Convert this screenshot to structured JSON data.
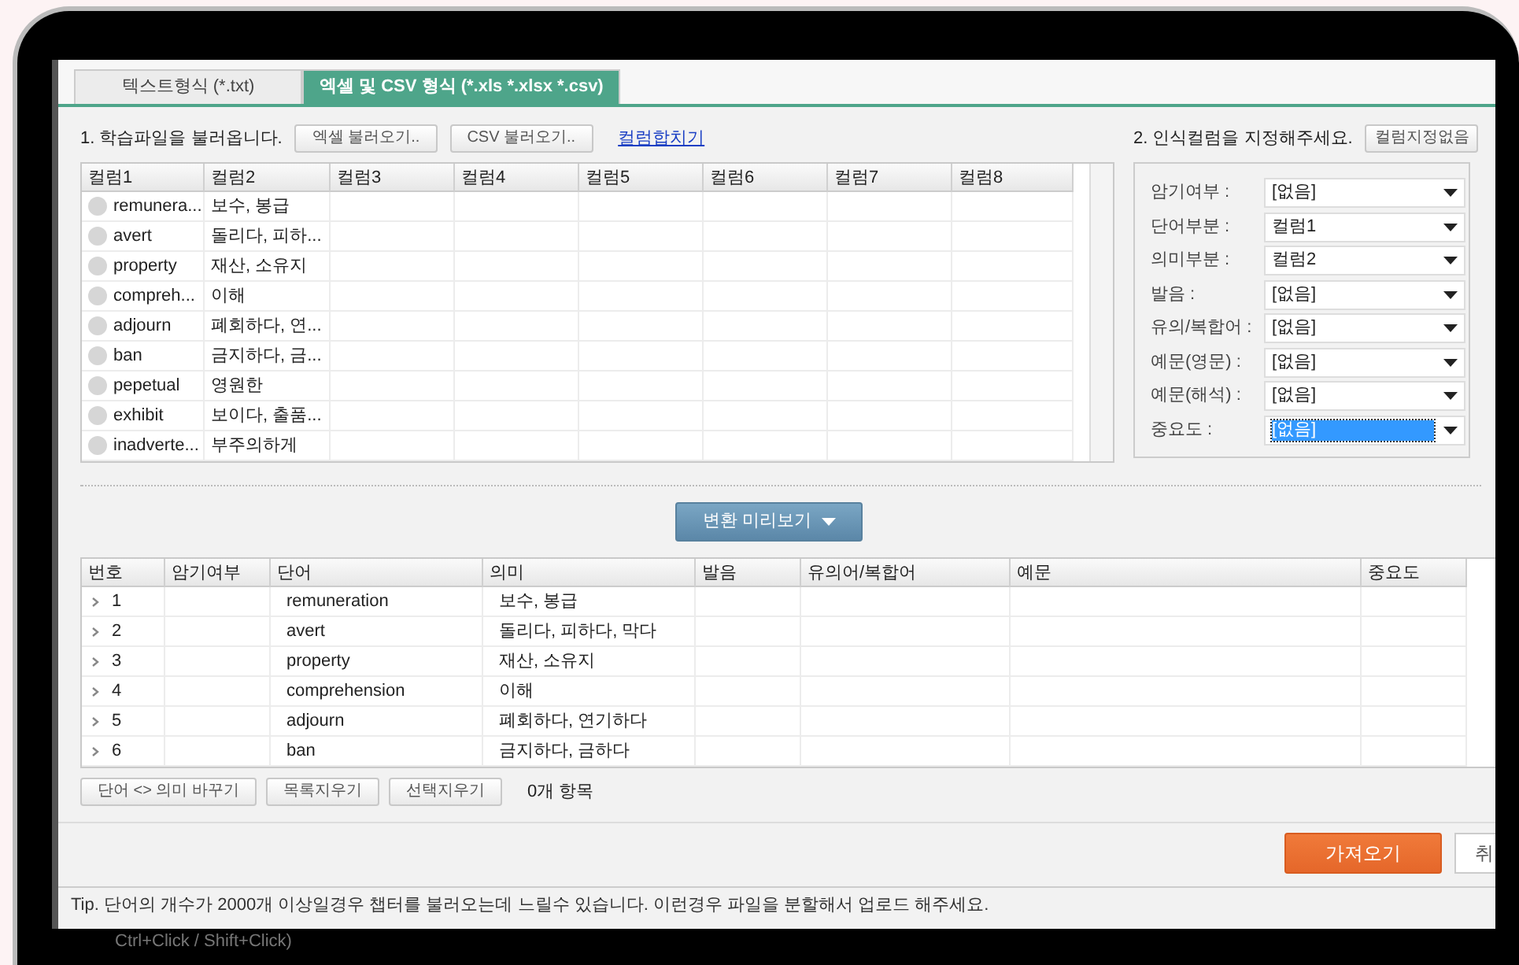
{
  "tabs": [
    {
      "label": "텍스트형식 (*.txt)",
      "selected": false
    },
    {
      "label": "엑셀 및 CSV 형식 (*.xls *.xlsx *.csv)",
      "selected": true
    }
  ],
  "load_section": {
    "label": "1. 학습파일을 불러옵니다.",
    "buttons": [
      "엑셀 불러오기..",
      "CSV 불러오기.."
    ],
    "link": "컬럼합치기"
  },
  "source_table": {
    "columns": [
      "컬럼1",
      "컬럼2",
      "컬럼3",
      "컬럼4",
      "컬럼5",
      "컬럼6",
      "컬럼7",
      "컬럼8"
    ],
    "rows": [
      {
        "checked": false,
        "cells": [
          "remunera...",
          "보수, 봉급"
        ]
      },
      {
        "checked": false,
        "cells": [
          "avert",
          "돌리다, 피하..."
        ]
      },
      {
        "checked": false,
        "cells": [
          "property",
          "재산, 소유지"
        ]
      },
      {
        "checked": false,
        "cells": [
          "compreh...",
          "이해"
        ]
      },
      {
        "checked": false,
        "cells": [
          "adjourn",
          "폐회하다, 연..."
        ]
      },
      {
        "checked": false,
        "cells": [
          "ban",
          "금지하다, 금..."
        ]
      },
      {
        "checked": false,
        "cells": [
          "pepetual",
          "영원한"
        ]
      },
      {
        "checked": false,
        "cells": [
          "exhibit",
          "보이다, 출품..."
        ]
      },
      {
        "checked": false,
        "cells": [
          "inadverte...",
          "부주의하게"
        ]
      }
    ]
  },
  "mapping_section": {
    "label": "2. 인식컬럼을 지정해주세요.",
    "button": "컬럼지정없음",
    "fields": [
      {
        "label": "암기여부 :",
        "value": "[없음]",
        "selected": false
      },
      {
        "label": "단어부분 :",
        "value": "컬럼1",
        "selected": false
      },
      {
        "label": "의미부분 :",
        "value": "컬럼2",
        "selected": false
      },
      {
        "label": "발음 :",
        "value": "[없음]",
        "selected": false
      },
      {
        "label": "유의/복합어 :",
        "value": "[없음]",
        "selected": false
      },
      {
        "label": "예문(영문) :",
        "value": "[없음]",
        "selected": false
      },
      {
        "label": "예문(해석) :",
        "value": "[없음]",
        "selected": false
      },
      {
        "label": "중요도 :",
        "value": "[없음]",
        "selected": true
      }
    ]
  },
  "preview_button": "변환 미리보기",
  "preview_table": {
    "columns": [
      "번호",
      "암기여부",
      "단어",
      "의미",
      "발음",
      "유의어/복합어",
      "예문",
      "중요도"
    ],
    "rows": [
      {
        "cells": [
          "1",
          "",
          "remuneration",
          "보수, 봉급"
        ]
      },
      {
        "cells": [
          "2",
          "",
          "avert",
          "돌리다, 피하다, 막다"
        ]
      },
      {
        "cells": [
          "3",
          "",
          "property",
          "재산, 소유지"
        ]
      },
      {
        "cells": [
          "4",
          "",
          "comprehension",
          "이해"
        ]
      },
      {
        "cells": [
          "5",
          "",
          "adjourn",
          "폐회하다, 연기하다"
        ]
      },
      {
        "cells": [
          "6",
          "",
          "ban",
          "금지하다, 금하다"
        ]
      }
    ]
  },
  "list_buttons": [
    "단어 <> 의미 바꾸기",
    "목록지우기",
    "선택지우기"
  ],
  "item_count": "0개 항목",
  "import_button": "가져오기",
  "cancel_button": "취",
  "tip": "Tip. 단어의 개수가 2000개 이상일경우 챕터를 불러오는데 느릴수 있습니다. 이런경우 파일을 분할해서 업로드 해주세요.",
  "background_hint": "Ctrl+Click / Shift+Click)"
}
